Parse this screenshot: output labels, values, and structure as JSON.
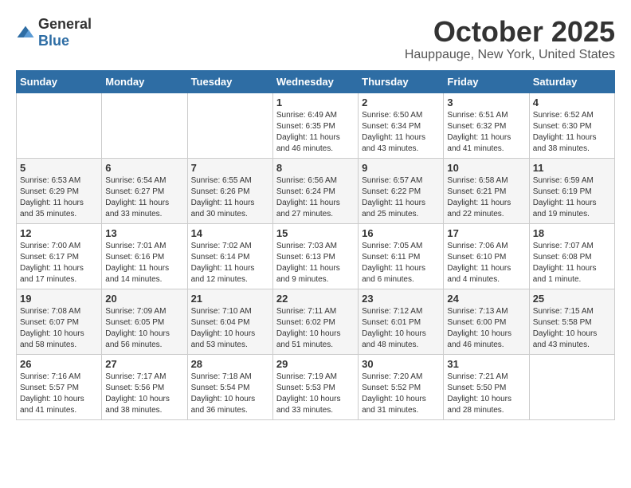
{
  "header": {
    "logo": {
      "general": "General",
      "blue": "Blue"
    },
    "title": "October 2025",
    "subtitle": "Hauppauge, New York, United States"
  },
  "weekdays": [
    "Sunday",
    "Monday",
    "Tuesday",
    "Wednesday",
    "Thursday",
    "Friday",
    "Saturday"
  ],
  "weeks": [
    [
      {
        "day": "",
        "sunrise": "",
        "sunset": "",
        "daylight": ""
      },
      {
        "day": "",
        "sunrise": "",
        "sunset": "",
        "daylight": ""
      },
      {
        "day": "",
        "sunrise": "",
        "sunset": "",
        "daylight": ""
      },
      {
        "day": "1",
        "sunrise": "Sunrise: 6:49 AM",
        "sunset": "Sunset: 6:35 PM",
        "daylight": "Daylight: 11 hours and 46 minutes."
      },
      {
        "day": "2",
        "sunrise": "Sunrise: 6:50 AM",
        "sunset": "Sunset: 6:34 PM",
        "daylight": "Daylight: 11 hours and 43 minutes."
      },
      {
        "day": "3",
        "sunrise": "Sunrise: 6:51 AM",
        "sunset": "Sunset: 6:32 PM",
        "daylight": "Daylight: 11 hours and 41 minutes."
      },
      {
        "day": "4",
        "sunrise": "Sunrise: 6:52 AM",
        "sunset": "Sunset: 6:30 PM",
        "daylight": "Daylight: 11 hours and 38 minutes."
      }
    ],
    [
      {
        "day": "5",
        "sunrise": "Sunrise: 6:53 AM",
        "sunset": "Sunset: 6:29 PM",
        "daylight": "Daylight: 11 hours and 35 minutes."
      },
      {
        "day": "6",
        "sunrise": "Sunrise: 6:54 AM",
        "sunset": "Sunset: 6:27 PM",
        "daylight": "Daylight: 11 hours and 33 minutes."
      },
      {
        "day": "7",
        "sunrise": "Sunrise: 6:55 AM",
        "sunset": "Sunset: 6:26 PM",
        "daylight": "Daylight: 11 hours and 30 minutes."
      },
      {
        "day": "8",
        "sunrise": "Sunrise: 6:56 AM",
        "sunset": "Sunset: 6:24 PM",
        "daylight": "Daylight: 11 hours and 27 minutes."
      },
      {
        "day": "9",
        "sunrise": "Sunrise: 6:57 AM",
        "sunset": "Sunset: 6:22 PM",
        "daylight": "Daylight: 11 hours and 25 minutes."
      },
      {
        "day": "10",
        "sunrise": "Sunrise: 6:58 AM",
        "sunset": "Sunset: 6:21 PM",
        "daylight": "Daylight: 11 hours and 22 minutes."
      },
      {
        "day": "11",
        "sunrise": "Sunrise: 6:59 AM",
        "sunset": "Sunset: 6:19 PM",
        "daylight": "Daylight: 11 hours and 19 minutes."
      }
    ],
    [
      {
        "day": "12",
        "sunrise": "Sunrise: 7:00 AM",
        "sunset": "Sunset: 6:17 PM",
        "daylight": "Daylight: 11 hours and 17 minutes."
      },
      {
        "day": "13",
        "sunrise": "Sunrise: 7:01 AM",
        "sunset": "Sunset: 6:16 PM",
        "daylight": "Daylight: 11 hours and 14 minutes."
      },
      {
        "day": "14",
        "sunrise": "Sunrise: 7:02 AM",
        "sunset": "Sunset: 6:14 PM",
        "daylight": "Daylight: 11 hours and 12 minutes."
      },
      {
        "day": "15",
        "sunrise": "Sunrise: 7:03 AM",
        "sunset": "Sunset: 6:13 PM",
        "daylight": "Daylight: 11 hours and 9 minutes."
      },
      {
        "day": "16",
        "sunrise": "Sunrise: 7:05 AM",
        "sunset": "Sunset: 6:11 PM",
        "daylight": "Daylight: 11 hours and 6 minutes."
      },
      {
        "day": "17",
        "sunrise": "Sunrise: 7:06 AM",
        "sunset": "Sunset: 6:10 PM",
        "daylight": "Daylight: 11 hours and 4 minutes."
      },
      {
        "day": "18",
        "sunrise": "Sunrise: 7:07 AM",
        "sunset": "Sunset: 6:08 PM",
        "daylight": "Daylight: 11 hours and 1 minute."
      }
    ],
    [
      {
        "day": "19",
        "sunrise": "Sunrise: 7:08 AM",
        "sunset": "Sunset: 6:07 PM",
        "daylight": "Daylight: 10 hours and 58 minutes."
      },
      {
        "day": "20",
        "sunrise": "Sunrise: 7:09 AM",
        "sunset": "Sunset: 6:05 PM",
        "daylight": "Daylight: 10 hours and 56 minutes."
      },
      {
        "day": "21",
        "sunrise": "Sunrise: 7:10 AM",
        "sunset": "Sunset: 6:04 PM",
        "daylight": "Daylight: 10 hours and 53 minutes."
      },
      {
        "day": "22",
        "sunrise": "Sunrise: 7:11 AM",
        "sunset": "Sunset: 6:02 PM",
        "daylight": "Daylight: 10 hours and 51 minutes."
      },
      {
        "day": "23",
        "sunrise": "Sunrise: 7:12 AM",
        "sunset": "Sunset: 6:01 PM",
        "daylight": "Daylight: 10 hours and 48 minutes."
      },
      {
        "day": "24",
        "sunrise": "Sunrise: 7:13 AM",
        "sunset": "Sunset: 6:00 PM",
        "daylight": "Daylight: 10 hours and 46 minutes."
      },
      {
        "day": "25",
        "sunrise": "Sunrise: 7:15 AM",
        "sunset": "Sunset: 5:58 PM",
        "daylight": "Daylight: 10 hours and 43 minutes."
      }
    ],
    [
      {
        "day": "26",
        "sunrise": "Sunrise: 7:16 AM",
        "sunset": "Sunset: 5:57 PM",
        "daylight": "Daylight: 10 hours and 41 minutes."
      },
      {
        "day": "27",
        "sunrise": "Sunrise: 7:17 AM",
        "sunset": "Sunset: 5:56 PM",
        "daylight": "Daylight: 10 hours and 38 minutes."
      },
      {
        "day": "28",
        "sunrise": "Sunrise: 7:18 AM",
        "sunset": "Sunset: 5:54 PM",
        "daylight": "Daylight: 10 hours and 36 minutes."
      },
      {
        "day": "29",
        "sunrise": "Sunrise: 7:19 AM",
        "sunset": "Sunset: 5:53 PM",
        "daylight": "Daylight: 10 hours and 33 minutes."
      },
      {
        "day": "30",
        "sunrise": "Sunrise: 7:20 AM",
        "sunset": "Sunset: 5:52 PM",
        "daylight": "Daylight: 10 hours and 31 minutes."
      },
      {
        "day": "31",
        "sunrise": "Sunrise: 7:21 AM",
        "sunset": "Sunset: 5:50 PM",
        "daylight": "Daylight: 10 hours and 28 minutes."
      },
      {
        "day": "",
        "sunrise": "",
        "sunset": "",
        "daylight": ""
      }
    ]
  ]
}
